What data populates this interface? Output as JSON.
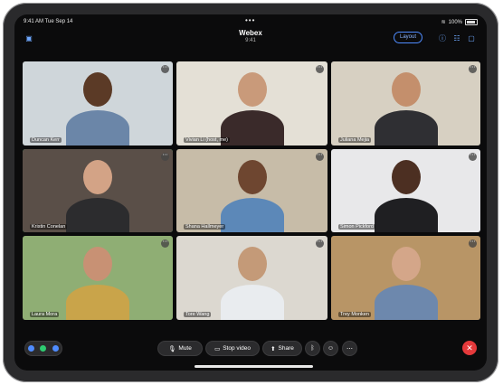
{
  "status": {
    "time": "9:41 AM",
    "date": "Tue Sep 14",
    "battery": "100%"
  },
  "header": {
    "title": "Webex",
    "time": "9:41",
    "layout_label": "Layout"
  },
  "participants": [
    {
      "name": "Duncan Kerr",
      "bg": "#cfd6da",
      "skin": "#5b3a26",
      "shirt": "#6b86a8"
    },
    {
      "name": "Vivian Li (host, me)",
      "bg": "#e4e0d6",
      "skin": "#c99a7a",
      "shirt": "#3a2a2a"
    },
    {
      "name": "Juliana Mejia",
      "bg": "#d7d0c2",
      "skin": "#c48f6c",
      "shirt": "#2f2f33"
    },
    {
      "name": "Kristin Conelan",
      "bg": "#5a4f48",
      "skin": "#d3a386",
      "shirt": "#2c2c2e"
    },
    {
      "name": "Shana Hallmeyer",
      "bg": "#c7bca8",
      "skin": "#6e4630",
      "shirt": "#5c88b8"
    },
    {
      "name": "Simon Pickford",
      "bg": "#e8e8ea",
      "skin": "#4c2f22",
      "shirt": "#1f1f22"
    },
    {
      "name": "Laura Mora",
      "bg": "#8fae74",
      "skin": "#c89174",
      "shirt": "#c9a44a"
    },
    {
      "name": "Tore Wang",
      "bg": "#dcd8d0",
      "skin": "#c49a78",
      "shirt": "#e9ecef"
    },
    {
      "name": "Trey Monken",
      "bg": "#b89566",
      "skin": "#d4a689",
      "shirt": "#6d88ad"
    }
  ],
  "controls": {
    "mute": "Mute",
    "stop_video": "Stop video",
    "share": "Share"
  },
  "colors": {
    "accent": "#2ecc71",
    "leave": "#e5393b",
    "brand": "#4f8cff"
  },
  "icons": [
    "sidebar-icon",
    "info-icon",
    "participants-icon",
    "chat-icon",
    "mic-icon",
    "video-icon",
    "share-icon",
    "bluetooth-icon",
    "reactions-icon",
    "more-icon",
    "end-call-icon"
  ]
}
